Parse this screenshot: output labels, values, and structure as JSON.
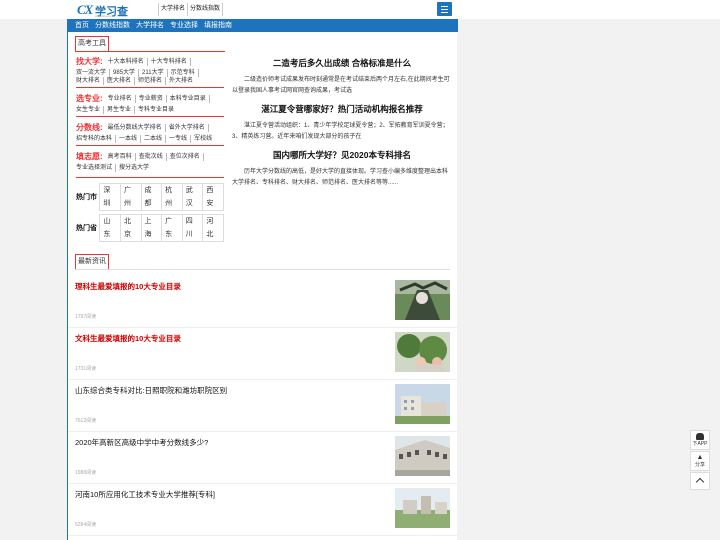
{
  "header": {
    "logo_mark": "CX",
    "logo_text": "学习查",
    "logo_sub": "xuexicha.com",
    "links": [
      "大学排名",
      "分数线指数"
    ]
  },
  "nav": [
    "首页",
    "分数线指数",
    "大学排名",
    "专业选择",
    "填报指南"
  ],
  "tools": {
    "title": "高考工具",
    "find_uni": {
      "label": "找大学:",
      "links": [
        "十大本科排名",
        "十大专科排名",
        "双一流大学",
        "985大学",
        "211大学",
        "示范专科",
        "财大排名",
        "医大排名",
        "师范排名",
        "外大排名"
      ]
    },
    "major": {
      "label": "选专业:",
      "links": [
        "专业排名",
        "专业薪资",
        "本科专业目录",
        "女生专业",
        "男生专业",
        "专科专业目录"
      ]
    },
    "score": {
      "label": "分数线:",
      "links": [
        "最低分数线大学排名",
        "省外大学排名",
        "招专科的本科",
        "一本线",
        "二本线",
        "一专线",
        "军校线"
      ]
    },
    "apply": {
      "label": "填志愿:",
      "links": [
        "高考百科",
        "查批次线",
        "查位次排名",
        "专业选择测试",
        "搜分选大学"
      ]
    },
    "hot_city": {
      "label": "热门市",
      "items": [
        "深圳",
        "广州",
        "成都",
        "杭州",
        "武汉",
        "西安"
      ]
    },
    "hot_prov": {
      "label": "热门省",
      "items": [
        "山东",
        "北京",
        "上海",
        "广东",
        "四川",
        "河北"
      ]
    }
  },
  "news": [
    {
      "title": "二造考后多久出成绩 合格标准是什么",
      "summary": "二级造价师考试成果发布时刻通常是在考试结束后两个月左右,在此期间考生可以登录我国人事考试网官网查询成果，考试选"
    },
    {
      "title": "湛江夏令营哪家好？热门活动机构报名推荐",
      "summary": "湛江夏令营活动组织：1、青少年学校足球夏令营；2、军拓教育军训夏令营；3、精英练习营。近年来咱们发现大部分的孩子在"
    },
    {
      "title": "国内哪所大学好？见2020本专科排名",
      "summary": "历年大学分数线的高低，是好大学的直接体现。学习查小编多维度整理出本科大学排名、专科排名、财大排名、师范排名、医大排名等等......"
    }
  ],
  "latest": {
    "title": "最新资讯",
    "items": [
      {
        "title": "理科生最爱填报的10大专业目录",
        "views": "1797阅读",
        "highlight": true
      },
      {
        "title": "文科生最爱填报的10大专业目录",
        "views": "1731阅读",
        "highlight": true
      },
      {
        "title": "山东综合类专科对比:日照职院和潍坊职院区别",
        "views": "7612阅读",
        "highlight": false
      },
      {
        "title": "2020年高新区高级中学中考分数线多少?",
        "views": "1988阅读",
        "highlight": false
      },
      {
        "title": "河南10所应用化工技术专业大学推荐[专科]",
        "views": "5284阅读",
        "highlight": false
      }
    ]
  },
  "sidebar": {
    "app": "下APP",
    "share": "分享"
  },
  "colors": {
    "brand": "#1e73be",
    "accent": "#e33333"
  }
}
